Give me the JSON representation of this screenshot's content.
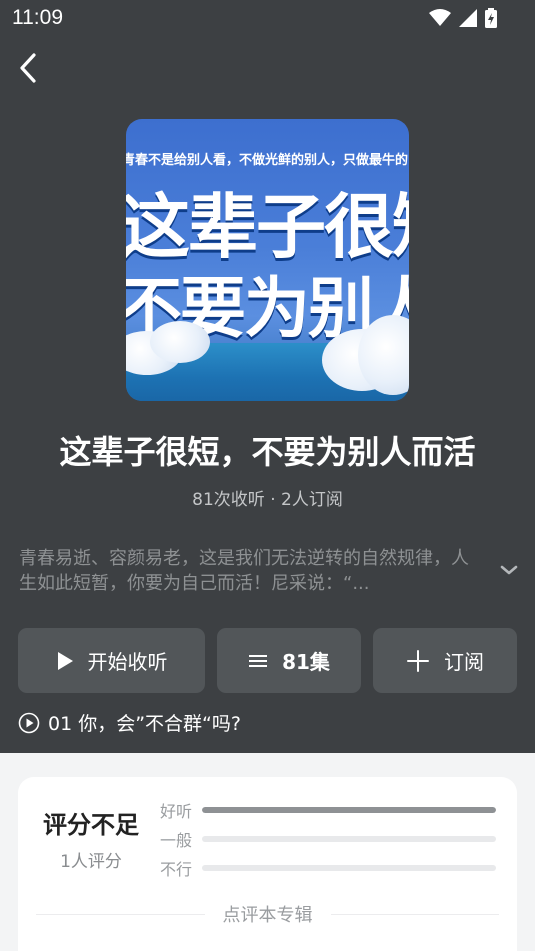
{
  "status_bar": {
    "time": "11:09"
  },
  "album": {
    "cover": {
      "top_text": "青春不是给别人看，不做光鲜的别人，只做最牛的自己",
      "line1": "这辈子很短",
      "line2": "不要为别人而活"
    },
    "title": "这辈子很短，不要为别人而活",
    "stats": "81次收听 · 2人订阅",
    "description": "青春易逝、容颜易老，这是我们无法逆转的自然规律，人生如此短暂，你要为自己而活！尼采说：“..."
  },
  "actions": {
    "play_label": "开始收听",
    "episodes_label": "81集",
    "subscribe_label": "订阅"
  },
  "latest_episode": "01 你，会”不合群“吗?",
  "rating": {
    "summary": "评分不足",
    "count": "1人评分",
    "bars": [
      {
        "label": "好听",
        "fraction": 1.0
      },
      {
        "label": "一般",
        "fraction": 0.0
      },
      {
        "label": "不行",
        "fraction": 0.0
      }
    ],
    "review_label": "点评本专辑"
  },
  "colors": {
    "background": "#3d4043",
    "button": "#525659",
    "card": "#ffffff",
    "bar_fill": "#8e9194"
  }
}
